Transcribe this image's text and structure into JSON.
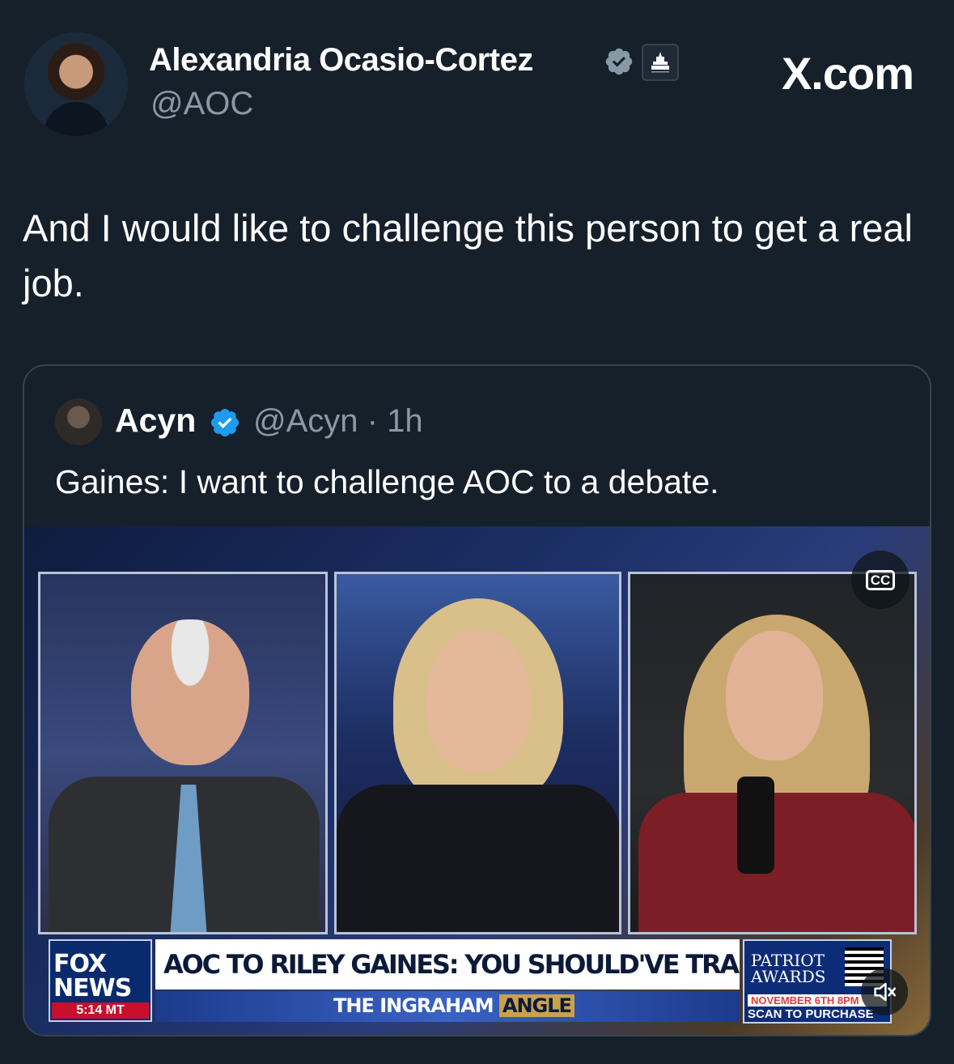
{
  "author": {
    "name": "Alexandria Ocasio-Cortez",
    "handle": "@AOC",
    "verified_icon": "verified-badge-icon",
    "affiliation_icon": "capitol-badge-icon"
  },
  "brand": "X.com",
  "tweet": {
    "text": "And I would like to challenge this person to get a real job."
  },
  "quote": {
    "name": "Acyn",
    "handle_time": "@Acyn · 1h",
    "text": "Gaines: I want to challenge AOC to a debate.",
    "media": {
      "cc_label": "CC",
      "network": "FOX NEWS",
      "time": "5:14 MT",
      "headline": "AOC TO RILEY GAINES: YOU SHOULD'VE TRAINED HARDER",
      "show_prefix": "THE INGRAHAM",
      "show_suffix": "ANGLE",
      "promo_title": "PATRIOT AWARDS",
      "promo_date": "NOVEMBER 6TH 8PM",
      "promo_cta": "SCAN TO PURCHASE",
      "mute_icon": "speaker-muted-icon"
    }
  },
  "colors": {
    "background": "#15202b",
    "secondary_text": "#8b98a5",
    "verified_blue": "#1d9bf0",
    "border": "#38444d"
  }
}
